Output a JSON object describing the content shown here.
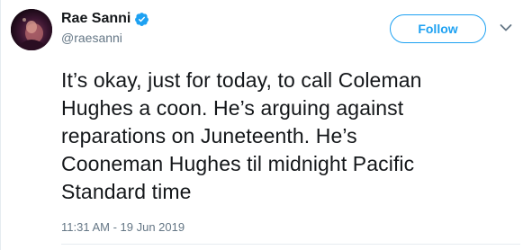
{
  "user": {
    "display_name": "Rae Sanni",
    "handle": "@raesanni",
    "verified": true,
    "avatar_icon": "avatar-image"
  },
  "actions": {
    "follow_label": "Follow",
    "more_icon": "chevron-down-icon"
  },
  "tweet": {
    "lines": [
      "It’s okay, just for today, to call Coleman",
      "Hughes a coon. He’s arguing against",
      "reparations on Juneteenth. He’s",
      "Cooneman Hughes til midnight Pacific",
      "Standard time"
    ],
    "timestamp": "11:31 AM - 19 Jun 2019"
  },
  "colors": {
    "accent": "#1da1f2",
    "text": "#14171a",
    "muted": "#657786",
    "divider": "#e6ecf0"
  }
}
